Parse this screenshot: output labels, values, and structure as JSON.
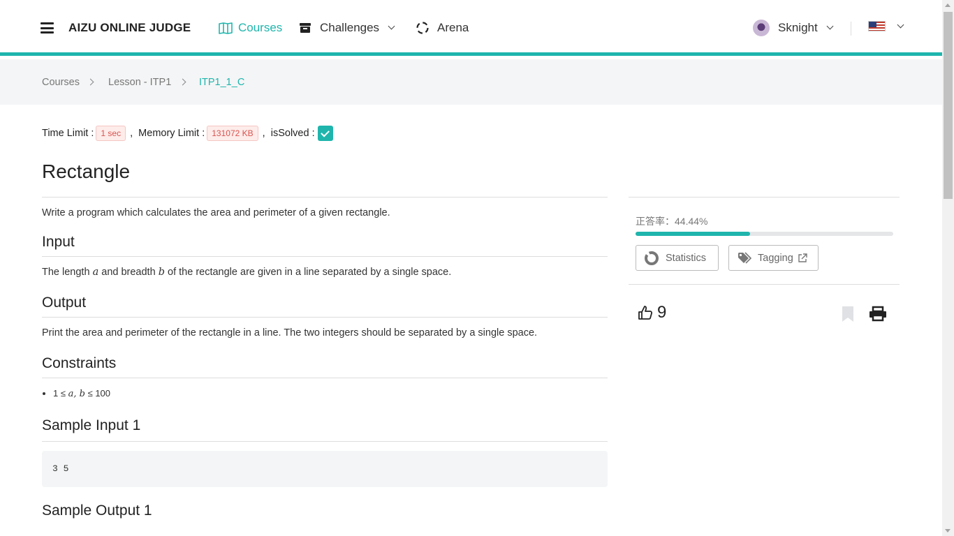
{
  "nav": {
    "brand": "AIZU ONLINE JUDGE",
    "courses": "Courses",
    "challenges": "Challenges",
    "arena": "Arena",
    "user": "Sknight",
    "accent": "#1fb5ad"
  },
  "breadcrumb": [
    "Courses",
    "Lesson - ITP1",
    "ITP1_1_C"
  ],
  "limits": {
    "time_label": "Time Limit :",
    "time_value": "1 sec",
    "memory_label": "Memory Limit :",
    "memory_value": "131072 KB",
    "solved_label": "isSolved :",
    "solved": true
  },
  "problem": {
    "title": "Rectangle",
    "statement": "Write a program which calculates the area and perimeter of a given rectangle.",
    "input_heading": "Input",
    "input_pre": "The length",
    "var_a": "a",
    "input_mid": "and breadth",
    "var_b": "b",
    "input_post": "of the rectangle are given in a line separated by a single space.",
    "output_heading": "Output",
    "output_text": "Print the area and perimeter of the rectangle in a line. The two integers should be separated by a single space.",
    "constraints_heading": "Constraints",
    "constraint_1": "1 ≤",
    "constraint_vars": "a, b",
    "constraint_2": "≤ 100",
    "sample_input_heading": "Sample Input 1",
    "sample_input": "3 5",
    "sample_output_heading": "Sample Output 1"
  },
  "side": {
    "rate_label": "正答率：44.44%",
    "rate_fraction": 0.4444,
    "statistics_label": "Statistics",
    "tagging_label": "Tagging",
    "likes": "9"
  }
}
